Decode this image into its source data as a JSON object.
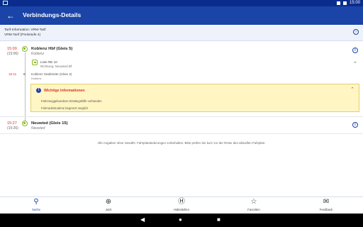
{
  "statusbar": {
    "time": "15:00"
  },
  "header": {
    "title": "Verbindungs-Details",
    "back_icon": "arrow-left-icon"
  },
  "tarif": {
    "line1": "Tarif-Information: VRM-Tarif",
    "line2": "VRM-Tarif (Preisstufe 4)"
  },
  "journey": {
    "start": {
      "time": "15:09",
      "time_planned": "(15:06)",
      "name": "Koblenz Hbf (Gleis 5)",
      "city": "Koblenz"
    },
    "train": {
      "line": "Linie RE 10",
      "direction": "Richtung: Neuwied Bf"
    },
    "intermediate": {
      "time": "15:11",
      "name": "Koblenz Stadtmitte (Gleis 3)",
      "city": "Koblenz"
    },
    "info": {
      "title": "Wichtige Informationen",
      "items": [
        "Fahrzeuggebundene Einstiegshilfe vorhanden",
        "Fahrradmitnahme begrenzt möglich"
      ]
    },
    "end": {
      "time": "15:27",
      "time_planned": "(15:26)",
      "name": "Neuwied (Gleis 15)",
      "city": "Neuwied"
    }
  },
  "footnote": "Alle Angaben ohne Gewähr. Fahrplanänderungen vorbehalten. Bitte prüfen Sie kurz vor der Reise den aktuellen Fahrplan.",
  "nav": [
    {
      "label": "Suche",
      "icon": "search-icon",
      "active": true
    },
    {
      "label": "Jetzt",
      "icon": "locate-icon",
      "active": false
    },
    {
      "label": "Haltestellen",
      "icon": "stop-icon",
      "active": false
    },
    {
      "label": "Favoriten",
      "icon": "star-icon",
      "active": false
    },
    {
      "label": "Feedback",
      "icon": "feedback-icon",
      "active": false
    }
  ],
  "colors": {
    "primary": "#1a44a8",
    "status_bar": "#0a2c8c",
    "realtime": "#e0302a",
    "line_green": "#8ab628",
    "info_bg": "#fff6c4"
  }
}
